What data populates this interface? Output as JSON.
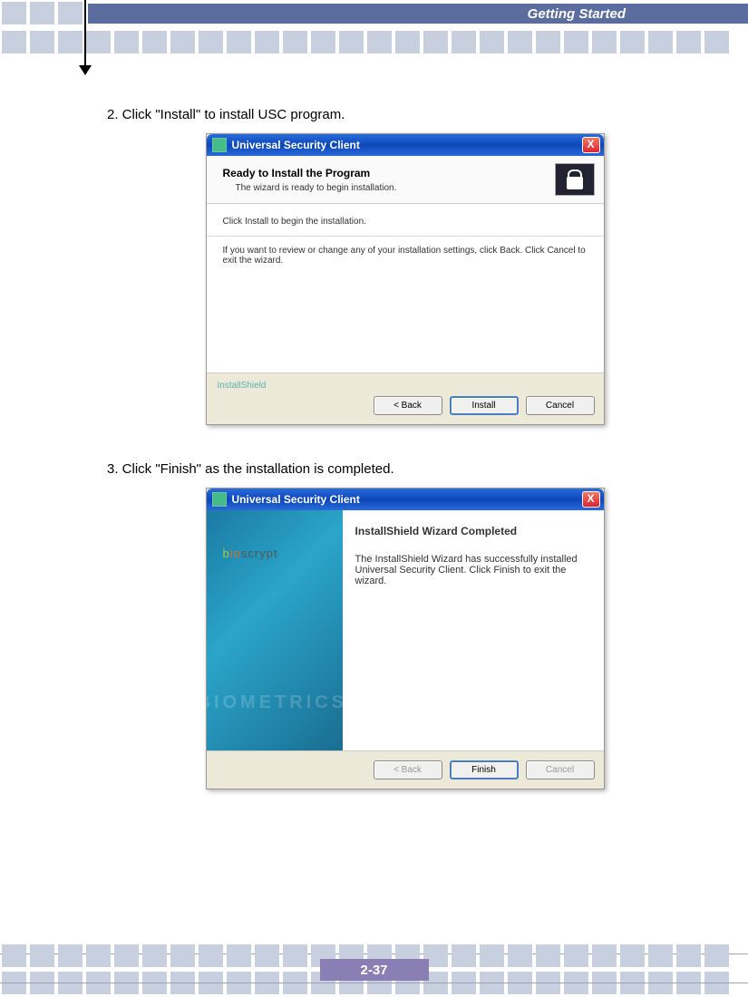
{
  "header": {
    "section_title": "Getting  Started"
  },
  "steps": {
    "s2": "2. Click \"Install\" to install USC program.",
    "s3": "3. Click \"Finish\" as the installation is completed."
  },
  "dialog1": {
    "title": "Universal Security Client",
    "heading": "Ready to Install the Program",
    "sub": "The wizard is ready to begin installation.",
    "line1": "Click Install to begin the installation.",
    "line2": "If you want to review or change any of your installation settings, click Back. Click Cancel to exit the wizard.",
    "brand": "InstallShield",
    "btn_back": "< Back",
    "btn_install": "Install",
    "btn_cancel": "Cancel"
  },
  "dialog2": {
    "title": "Universal Security Client",
    "logo": "bioscrypt",
    "wm": "BIOMETRICS",
    "heading": "InstallShield Wizard Completed",
    "body": "The InstallShield Wizard has successfully installed Universal Security Client. Click Finish to exit the wizard.",
    "btn_back": "< Back",
    "btn_finish": "Finish",
    "btn_cancel": "Cancel"
  },
  "page_number": "2-37"
}
